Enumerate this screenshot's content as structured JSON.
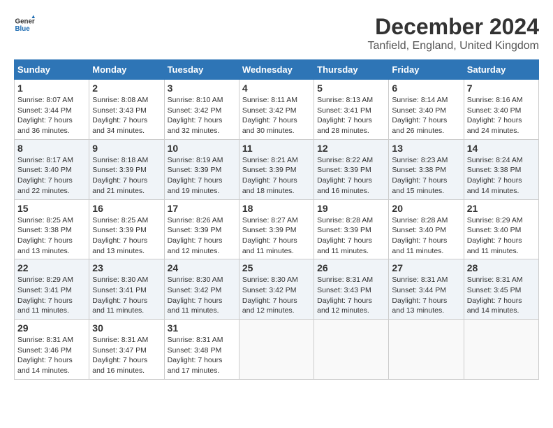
{
  "header": {
    "logo_line1": "General",
    "logo_line2": "Blue",
    "title": "December 2024",
    "subtitle": "Tanfield, England, United Kingdom"
  },
  "calendar": {
    "days_of_week": [
      "Sunday",
      "Monday",
      "Tuesday",
      "Wednesday",
      "Thursday",
      "Friday",
      "Saturday"
    ],
    "weeks": [
      [
        null,
        null,
        null,
        null,
        null,
        null,
        null
      ]
    ],
    "cells": [
      {
        "day": "1",
        "col": 0,
        "sunrise": "Sunrise: 8:07 AM",
        "sunset": "Sunset: 3:44 PM",
        "daylight": "Daylight: 7 hours and 36 minutes."
      },
      {
        "day": "2",
        "col": 1,
        "sunrise": "Sunrise: 8:08 AM",
        "sunset": "Sunset: 3:43 PM",
        "daylight": "Daylight: 7 hours and 34 minutes."
      },
      {
        "day": "3",
        "col": 2,
        "sunrise": "Sunrise: 8:10 AM",
        "sunset": "Sunset: 3:42 PM",
        "daylight": "Daylight: 7 hours and 32 minutes."
      },
      {
        "day": "4",
        "col": 3,
        "sunrise": "Sunrise: 8:11 AM",
        "sunset": "Sunset: 3:42 PM",
        "daylight": "Daylight: 7 hours and 30 minutes."
      },
      {
        "day": "5",
        "col": 4,
        "sunrise": "Sunrise: 8:13 AM",
        "sunset": "Sunset: 3:41 PM",
        "daylight": "Daylight: 7 hours and 28 minutes."
      },
      {
        "day": "6",
        "col": 5,
        "sunrise": "Sunrise: 8:14 AM",
        "sunset": "Sunset: 3:40 PM",
        "daylight": "Daylight: 7 hours and 26 minutes."
      },
      {
        "day": "7",
        "col": 6,
        "sunrise": "Sunrise: 8:16 AM",
        "sunset": "Sunset: 3:40 PM",
        "daylight": "Daylight: 7 hours and 24 minutes."
      },
      {
        "day": "8",
        "col": 0,
        "sunrise": "Sunrise: 8:17 AM",
        "sunset": "Sunset: 3:40 PM",
        "daylight": "Daylight: 7 hours and 22 minutes."
      },
      {
        "day": "9",
        "col": 1,
        "sunrise": "Sunrise: 8:18 AM",
        "sunset": "Sunset: 3:39 PM",
        "daylight": "Daylight: 7 hours and 21 minutes."
      },
      {
        "day": "10",
        "col": 2,
        "sunrise": "Sunrise: 8:19 AM",
        "sunset": "Sunset: 3:39 PM",
        "daylight": "Daylight: 7 hours and 19 minutes."
      },
      {
        "day": "11",
        "col": 3,
        "sunrise": "Sunrise: 8:21 AM",
        "sunset": "Sunset: 3:39 PM",
        "daylight": "Daylight: 7 hours and 18 minutes."
      },
      {
        "day": "12",
        "col": 4,
        "sunrise": "Sunrise: 8:22 AM",
        "sunset": "Sunset: 3:39 PM",
        "daylight": "Daylight: 7 hours and 16 minutes."
      },
      {
        "day": "13",
        "col": 5,
        "sunrise": "Sunrise: 8:23 AM",
        "sunset": "Sunset: 3:38 PM",
        "daylight": "Daylight: 7 hours and 15 minutes."
      },
      {
        "day": "14",
        "col": 6,
        "sunrise": "Sunrise: 8:24 AM",
        "sunset": "Sunset: 3:38 PM",
        "daylight": "Daylight: 7 hours and 14 minutes."
      },
      {
        "day": "15",
        "col": 0,
        "sunrise": "Sunrise: 8:25 AM",
        "sunset": "Sunset: 3:38 PM",
        "daylight": "Daylight: 7 hours and 13 minutes."
      },
      {
        "day": "16",
        "col": 1,
        "sunrise": "Sunrise: 8:25 AM",
        "sunset": "Sunset: 3:39 PM",
        "daylight": "Daylight: 7 hours and 13 minutes."
      },
      {
        "day": "17",
        "col": 2,
        "sunrise": "Sunrise: 8:26 AM",
        "sunset": "Sunset: 3:39 PM",
        "daylight": "Daylight: 7 hours and 12 minutes."
      },
      {
        "day": "18",
        "col": 3,
        "sunrise": "Sunrise: 8:27 AM",
        "sunset": "Sunset: 3:39 PM",
        "daylight": "Daylight: 7 hours and 11 minutes."
      },
      {
        "day": "19",
        "col": 4,
        "sunrise": "Sunrise: 8:28 AM",
        "sunset": "Sunset: 3:39 PM",
        "daylight": "Daylight: 7 hours and 11 minutes."
      },
      {
        "day": "20",
        "col": 5,
        "sunrise": "Sunrise: 8:28 AM",
        "sunset": "Sunset: 3:40 PM",
        "daylight": "Daylight: 7 hours and 11 minutes."
      },
      {
        "day": "21",
        "col": 6,
        "sunrise": "Sunrise: 8:29 AM",
        "sunset": "Sunset: 3:40 PM",
        "daylight": "Daylight: 7 hours and 11 minutes."
      },
      {
        "day": "22",
        "col": 0,
        "sunrise": "Sunrise: 8:29 AM",
        "sunset": "Sunset: 3:41 PM",
        "daylight": "Daylight: 7 hours and 11 minutes."
      },
      {
        "day": "23",
        "col": 1,
        "sunrise": "Sunrise: 8:30 AM",
        "sunset": "Sunset: 3:41 PM",
        "daylight": "Daylight: 7 hours and 11 minutes."
      },
      {
        "day": "24",
        "col": 2,
        "sunrise": "Sunrise: 8:30 AM",
        "sunset": "Sunset: 3:42 PM",
        "daylight": "Daylight: 7 hours and 11 minutes."
      },
      {
        "day": "25",
        "col": 3,
        "sunrise": "Sunrise: 8:30 AM",
        "sunset": "Sunset: 3:42 PM",
        "daylight": "Daylight: 7 hours and 12 minutes."
      },
      {
        "day": "26",
        "col": 4,
        "sunrise": "Sunrise: 8:31 AM",
        "sunset": "Sunset: 3:43 PM",
        "daylight": "Daylight: 7 hours and 12 minutes."
      },
      {
        "day": "27",
        "col": 5,
        "sunrise": "Sunrise: 8:31 AM",
        "sunset": "Sunset: 3:44 PM",
        "daylight": "Daylight: 7 hours and 13 minutes."
      },
      {
        "day": "28",
        "col": 6,
        "sunrise": "Sunrise: 8:31 AM",
        "sunset": "Sunset: 3:45 PM",
        "daylight": "Daylight: 7 hours and 14 minutes."
      },
      {
        "day": "29",
        "col": 0,
        "sunrise": "Sunrise: 8:31 AM",
        "sunset": "Sunset: 3:46 PM",
        "daylight": "Daylight: 7 hours and 14 minutes."
      },
      {
        "day": "30",
        "col": 1,
        "sunrise": "Sunrise: 8:31 AM",
        "sunset": "Sunset: 3:47 PM",
        "daylight": "Daylight: 7 hours and 16 minutes."
      },
      {
        "day": "31",
        "col": 2,
        "sunrise": "Sunrise: 8:31 AM",
        "sunset": "Sunset: 3:48 PM",
        "daylight": "Daylight: 7 hours and 17 minutes."
      }
    ]
  }
}
